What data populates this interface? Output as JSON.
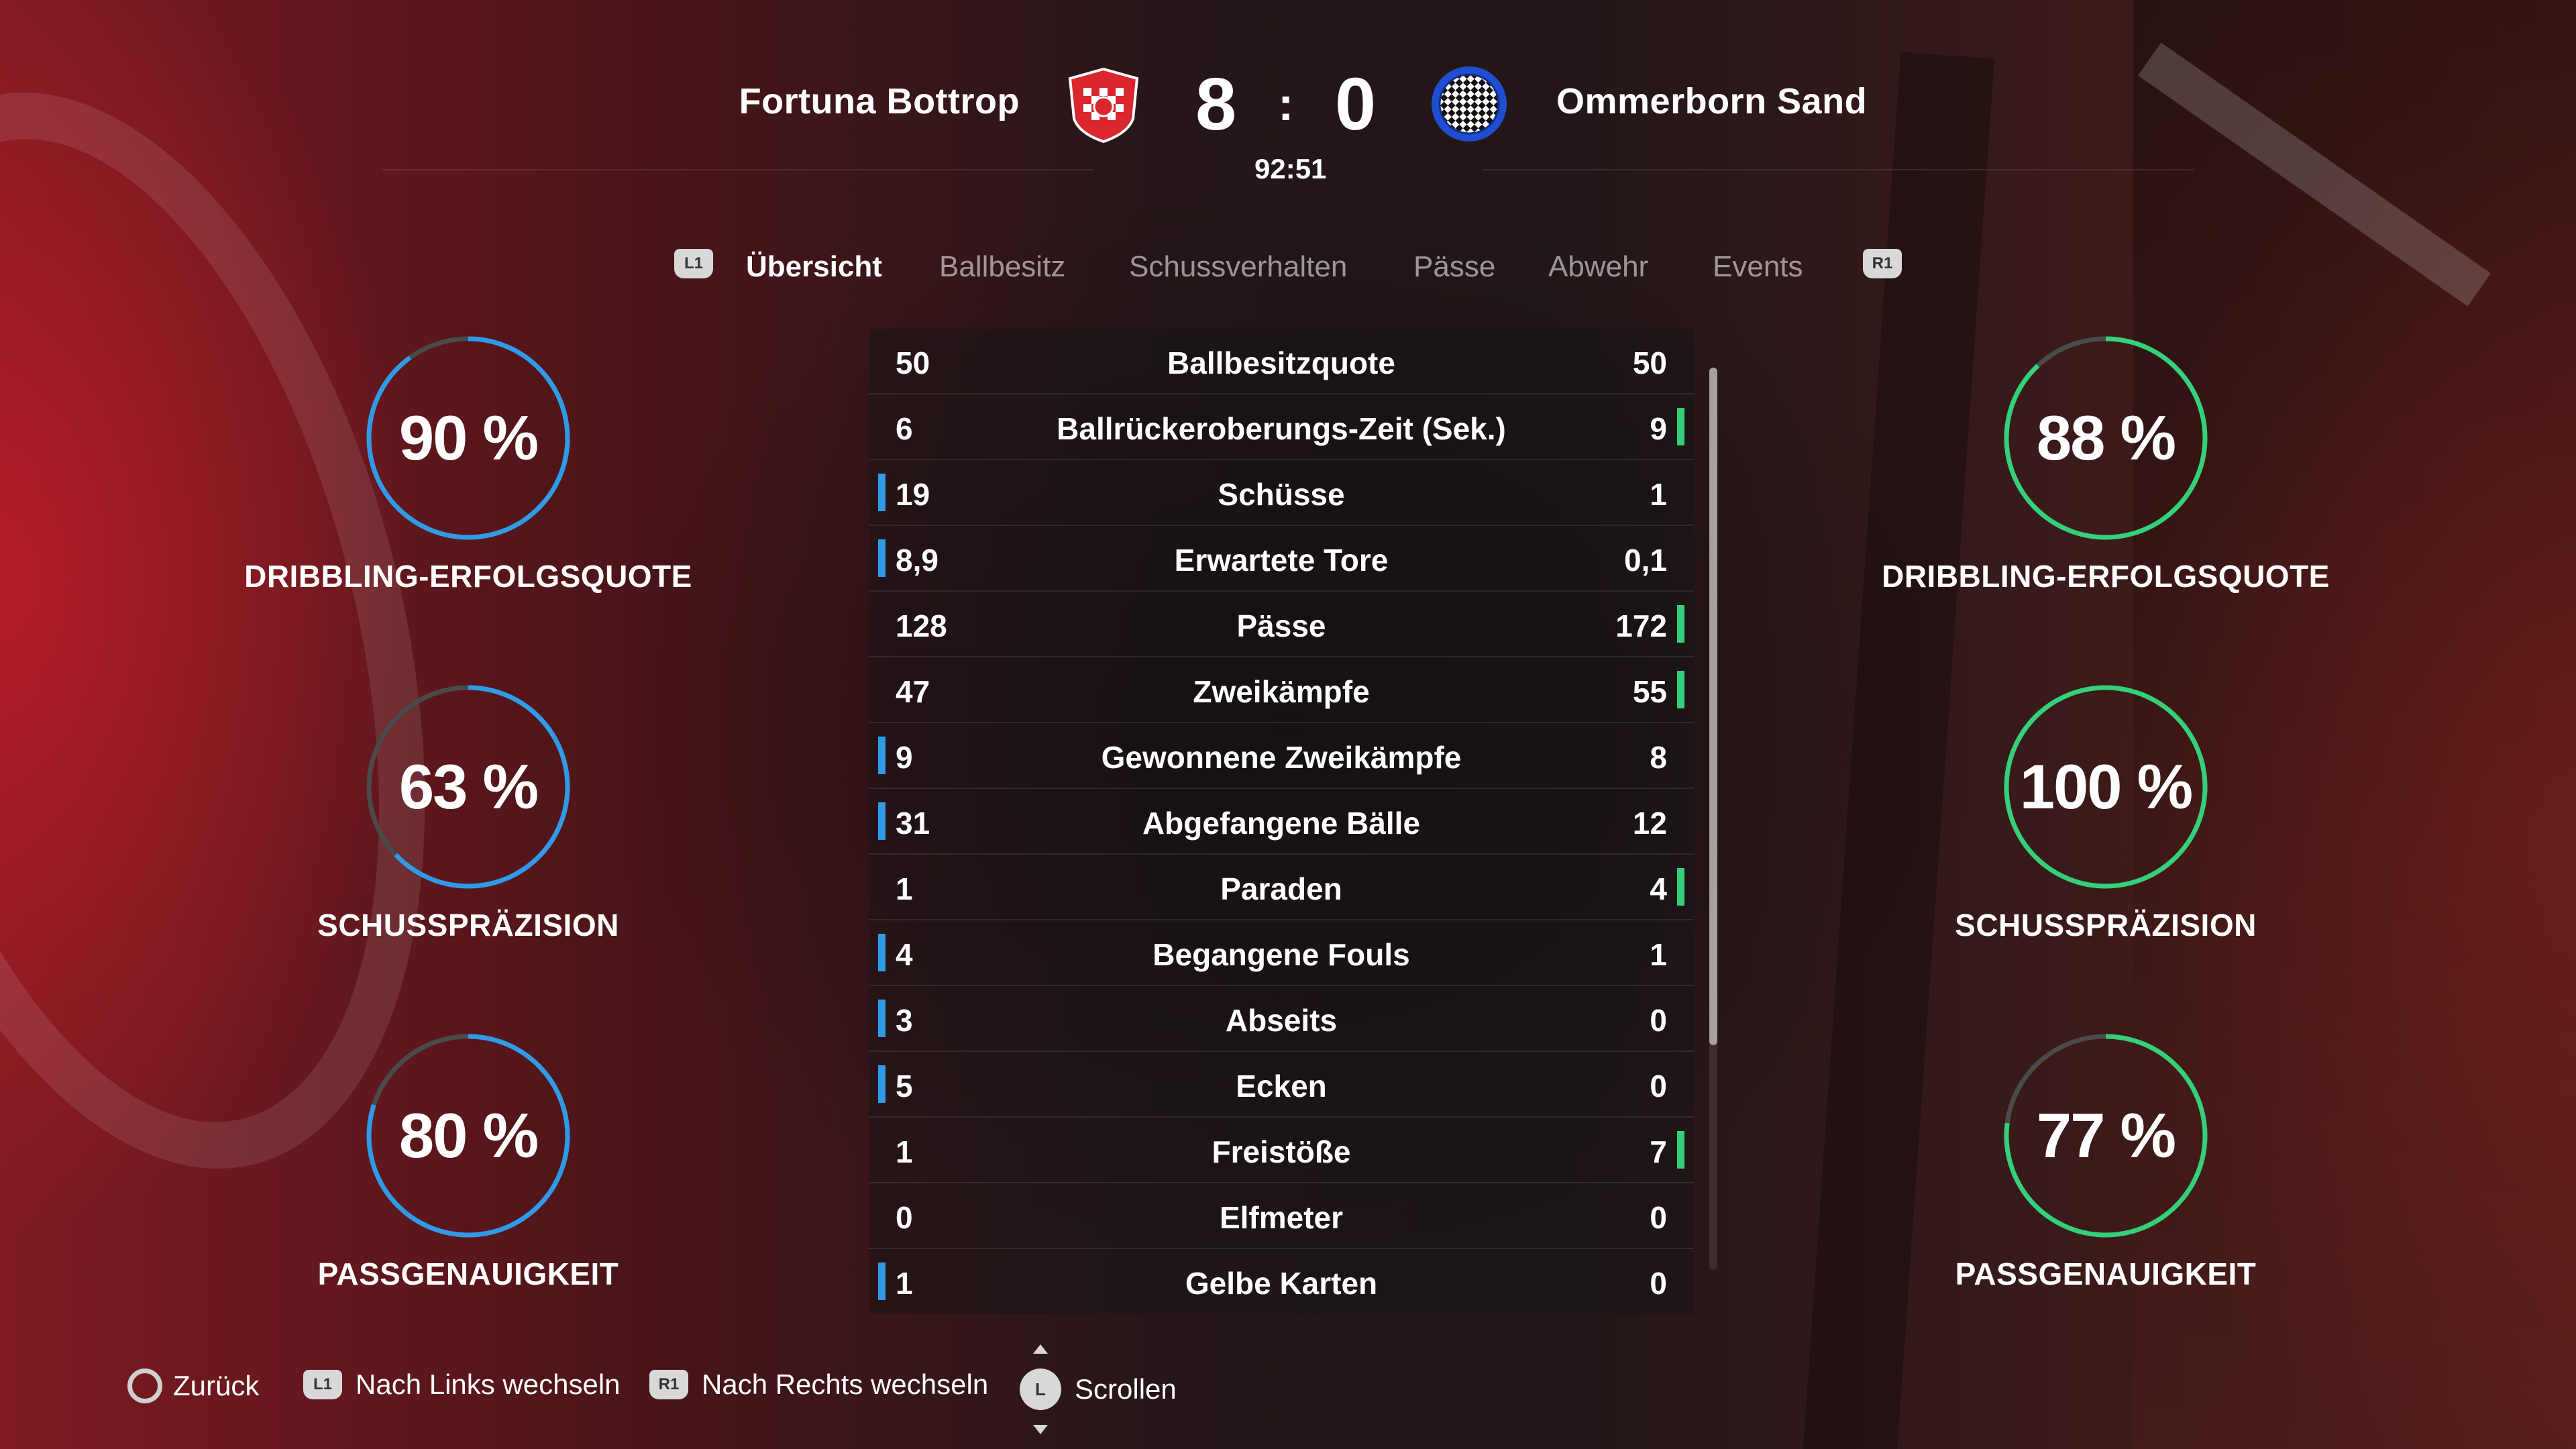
{
  "match": {
    "home_team": "Fortuna Bottrop",
    "away_team": "Ommerborn Sand",
    "home_score": "8",
    "away_score": "0",
    "separator": ":",
    "time": "92:51"
  },
  "tabs": {
    "left_shoulder": "L1",
    "right_shoulder": "R1",
    "items": [
      {
        "label": "Übersicht",
        "active": true
      },
      {
        "label": "Ballbesitz",
        "active": false
      },
      {
        "label": "Schussverhalten",
        "active": false
      },
      {
        "label": "Pässe",
        "active": false
      },
      {
        "label": "Abwehr",
        "active": false
      },
      {
        "label": "Events",
        "active": false
      }
    ]
  },
  "colors": {
    "home_accent": "#2f9be8",
    "away_accent": "#34d07a",
    "ring_track": "#4a4a4a"
  },
  "home_rings": [
    {
      "value": "90 %",
      "fraction": 0.9,
      "label": "DRIBBLING-ERFOLGSQUOTE"
    },
    {
      "value": "63 %",
      "fraction": 0.63,
      "label": "SCHUSSPRÄZISION"
    },
    {
      "value": "80 %",
      "fraction": 0.8,
      "label": "PASSGENAUIGKEIT"
    }
  ],
  "away_rings": [
    {
      "value": "88 %",
      "fraction": 0.88,
      "label": "DRIBBLING-ERFOLGSQUOTE"
    },
    {
      "value": "100 %",
      "fraction": 1.0,
      "label": "SCHUSSPRÄZISION"
    },
    {
      "value": "77 %",
      "fraction": 0.77,
      "label": "PASSGENAUIGKEIT"
    }
  ],
  "stats": [
    {
      "label": "Ballbesitzquote",
      "home": "50",
      "away": "50",
      "leader": "none"
    },
    {
      "label": "Ballrückeroberungs-Zeit (Sek.)",
      "home": "6",
      "away": "9",
      "leader": "away"
    },
    {
      "label": "Schüsse",
      "home": "19",
      "away": "1",
      "leader": "home"
    },
    {
      "label": "Erwartete Tore",
      "home": "8,9",
      "away": "0,1",
      "leader": "home"
    },
    {
      "label": "Pässe",
      "home": "128",
      "away": "172",
      "leader": "away"
    },
    {
      "label": "Zweikämpfe",
      "home": "47",
      "away": "55",
      "leader": "away"
    },
    {
      "label": "Gewonnene Zweikämpfe",
      "home": "9",
      "away": "8",
      "leader": "home"
    },
    {
      "label": "Abgefangene Bälle",
      "home": "31",
      "away": "12",
      "leader": "home"
    },
    {
      "label": "Paraden",
      "home": "1",
      "away": "4",
      "leader": "away"
    },
    {
      "label": "Begangene Fouls",
      "home": "4",
      "away": "1",
      "leader": "home"
    },
    {
      "label": "Abseits",
      "home": "3",
      "away": "0",
      "leader": "home"
    },
    {
      "label": "Ecken",
      "home": "5",
      "away": "0",
      "leader": "home"
    },
    {
      "label": "Freistöße",
      "home": "1",
      "away": "7",
      "leader": "away"
    },
    {
      "label": "Elfmeter",
      "home": "0",
      "away": "0",
      "leader": "none"
    },
    {
      "label": "Gelbe Karten",
      "home": "1",
      "away": "0",
      "leader": "home"
    }
  ],
  "footer": {
    "back": "Zurück",
    "left_btn": "L1",
    "left": "Nach Links wechseln",
    "right_btn": "R1",
    "right": "Nach Rechts wechseln",
    "stick_btn": "L",
    "scroll": "Scrollen"
  }
}
